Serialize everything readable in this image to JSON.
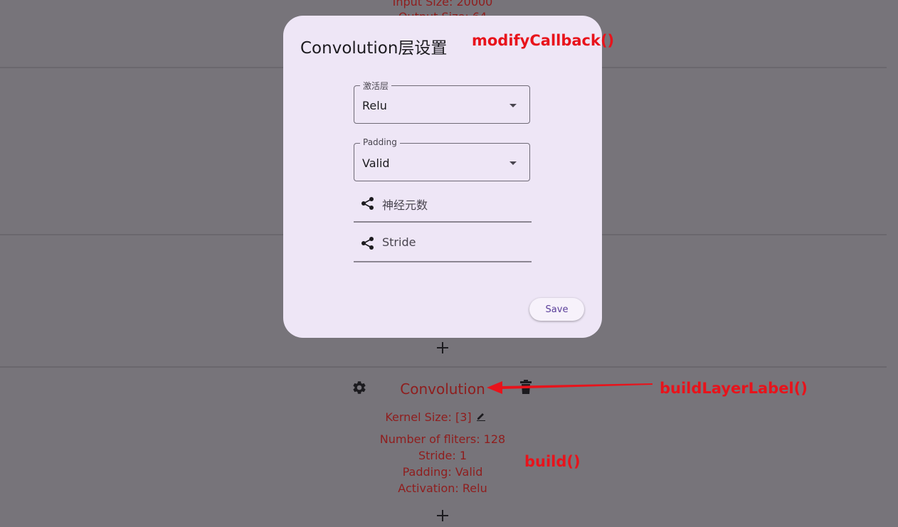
{
  "background": {
    "top_lines": [
      "Input Size: 20000",
      "Output Size: 64"
    ],
    "layer": {
      "title": "Convolution",
      "kernel_size": "Kernel Size: [3]",
      "details": [
        "Number of fliters: 128",
        "Stride: 1",
        "Padding: Valid",
        "Activation: Relu"
      ]
    }
  },
  "dialog": {
    "title": "Convolution层设置",
    "activation": {
      "label": "激活层",
      "value": "Relu"
    },
    "padding": {
      "label": "Padding",
      "value": "Valid"
    },
    "rows": [
      {
        "label": "神经元数",
        "icon": "share-icon"
      },
      {
        "label": "Stride",
        "icon": "share-icon"
      }
    ],
    "save_label": "Save"
  },
  "annotations": {
    "modify": "modifyCallback()",
    "label": "buildLayerLabel()",
    "build": "build()"
  },
  "colors": {
    "scrim": "#77747a",
    "layer_text": "#8f1d1d",
    "dialog_bg": "#eee6f6",
    "annotation": "#e8131b",
    "button_text": "#5b3f9a"
  }
}
